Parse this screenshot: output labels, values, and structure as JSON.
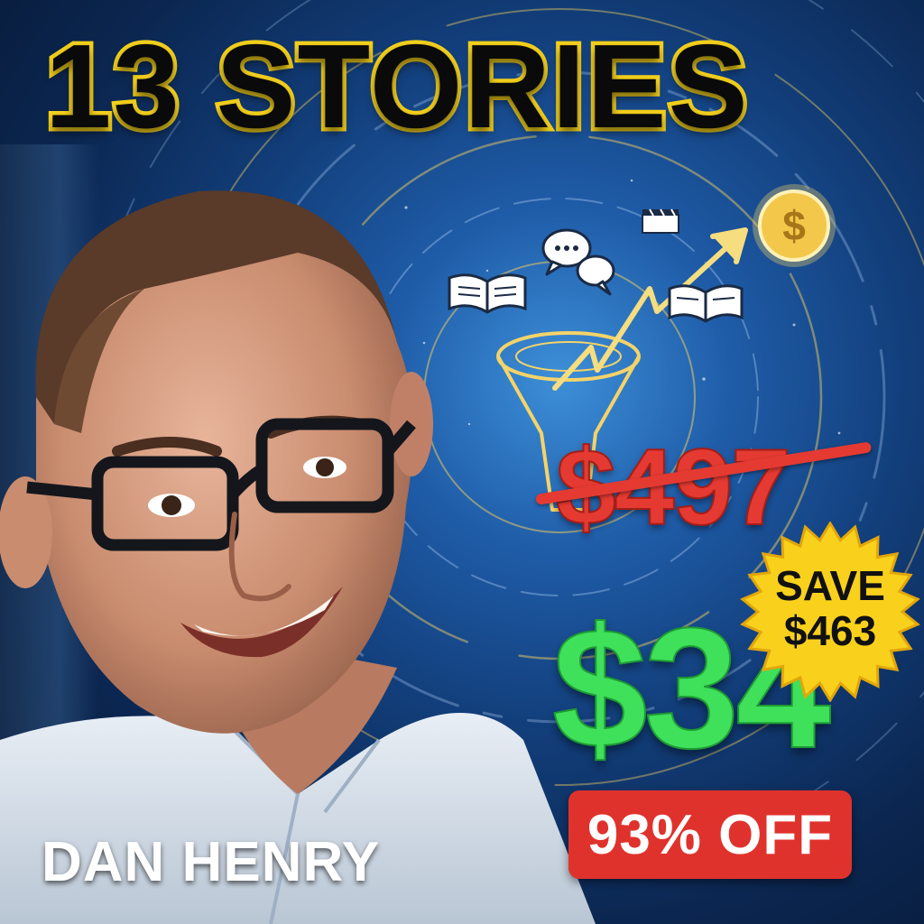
{
  "headline": "13 STORIES",
  "pricing": {
    "old_price": "$497",
    "new_price": "$34",
    "savings_line1": "SAVE",
    "savings_line2": "$463",
    "discount": "93% OFF"
  },
  "author": "DAN HENRY",
  "colors": {
    "headline_fill": "#0a0a0a",
    "headline_outline": "#f6d21c",
    "old_price": "#e43a32",
    "new_price": "#3fe05a",
    "burst": "#f9d11c",
    "discount_bg": "#e0322c",
    "background": "#1f5ca8"
  },
  "icons": [
    "open-book-icon",
    "chat-bubbles-icon",
    "film-clapper-icon",
    "dollar-coin-icon",
    "trend-arrow-icon",
    "funnel-icon",
    "open-book-icon"
  ]
}
